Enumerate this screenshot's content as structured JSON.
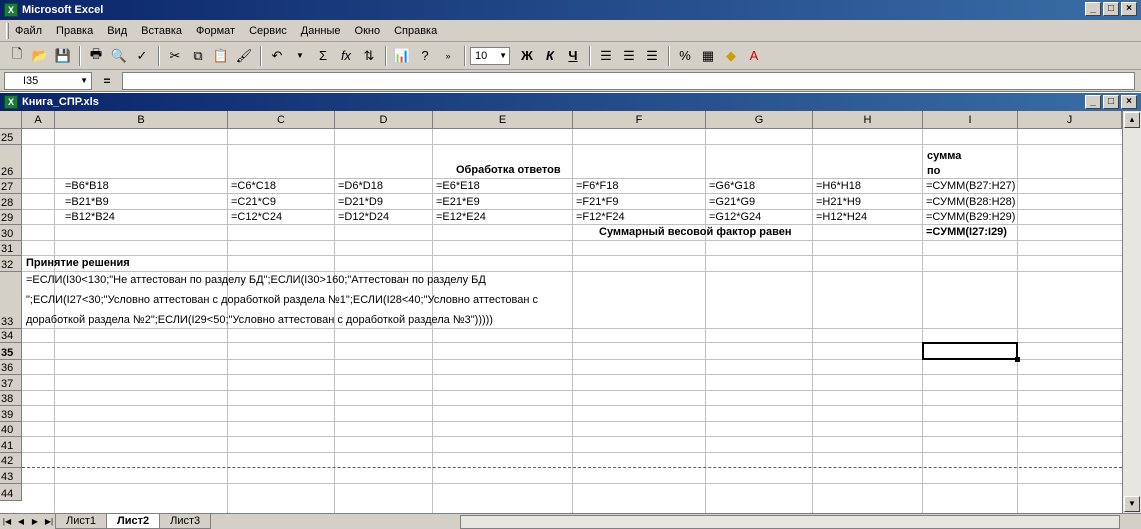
{
  "app": {
    "title": "Microsoft Excel",
    "workbook_title": "Книга_СПР.xls"
  },
  "window_buttons": [
    "_",
    "□",
    "×"
  ],
  "menu": [
    "Файл",
    "Правка",
    "Вид",
    "Вставка",
    "Формат",
    "Сервис",
    "Данные",
    "Окно",
    "Справка"
  ],
  "toolbar": {
    "font_size": "10",
    "bold": "Ж",
    "italic": "К",
    "underline": "Ч",
    "sum": "Σ",
    "fx": "fx",
    "percent": "%"
  },
  "formula_bar": {
    "name_box": "I35",
    "equals": "="
  },
  "columns": [
    "A",
    "B",
    "C",
    "D",
    "E",
    "F",
    "G",
    "H",
    "I",
    "J"
  ],
  "rows": [
    "25",
    "26",
    "27",
    "28",
    "29",
    "30",
    "31",
    "32",
    "33",
    "34",
    "35",
    "36",
    "37",
    "38",
    "39",
    "40",
    "41",
    "42",
    "43",
    "44"
  ],
  "cells": {
    "r26_header": "Обработка ответов",
    "r26_sum1": "сумма",
    "r26_sum2": "по",
    "r27": [
      "=B6*B18",
      "=C6*C18",
      "=D6*D18",
      "=E6*E18",
      "=F6*F18",
      "=G6*G18",
      "=H6*H18",
      "=СУММ(B27:H27)"
    ],
    "r28": [
      "=B21*B9",
      "=C21*C9",
      "=D21*D9",
      "=E21*E9",
      "=F21*F9",
      "=G21*G9",
      "=H21*H9",
      "=СУММ(B28:H28)"
    ],
    "r29": [
      "=B12*B24",
      "=C12*C24",
      "=D12*D24",
      "=E12*E24",
      "=F12*F24",
      "=G12*G24",
      "=H12*H24",
      "=СУММ(B29:H29)"
    ],
    "r30_label": "Суммарный весовой фактор равен",
    "r30_formula": "=СУММ(I27:I29)",
    "r32_label": "Принятие решения",
    "r33_line1": "=ЕСЛИ(I30<130;\"Не аттестован по разделу БД\";ЕСЛИ(I30>160;\"Аттестован по разделу БД",
    "r33_line2": "\";ЕСЛИ(I27<30;\"Условно аттестован с доработкой раздела №1\";ЕСЛИ(I28<40;\"Условно аттестован с",
    "r33_line3": "доработкой раздела №2\";ЕСЛИ(I29<50;\"Условно аттестован с доработкой раздела №3\")))))"
  },
  "sheet_tabs": [
    "Лист1",
    "Лист2",
    "Лист3"
  ],
  "active_sheet": "Лист2"
}
